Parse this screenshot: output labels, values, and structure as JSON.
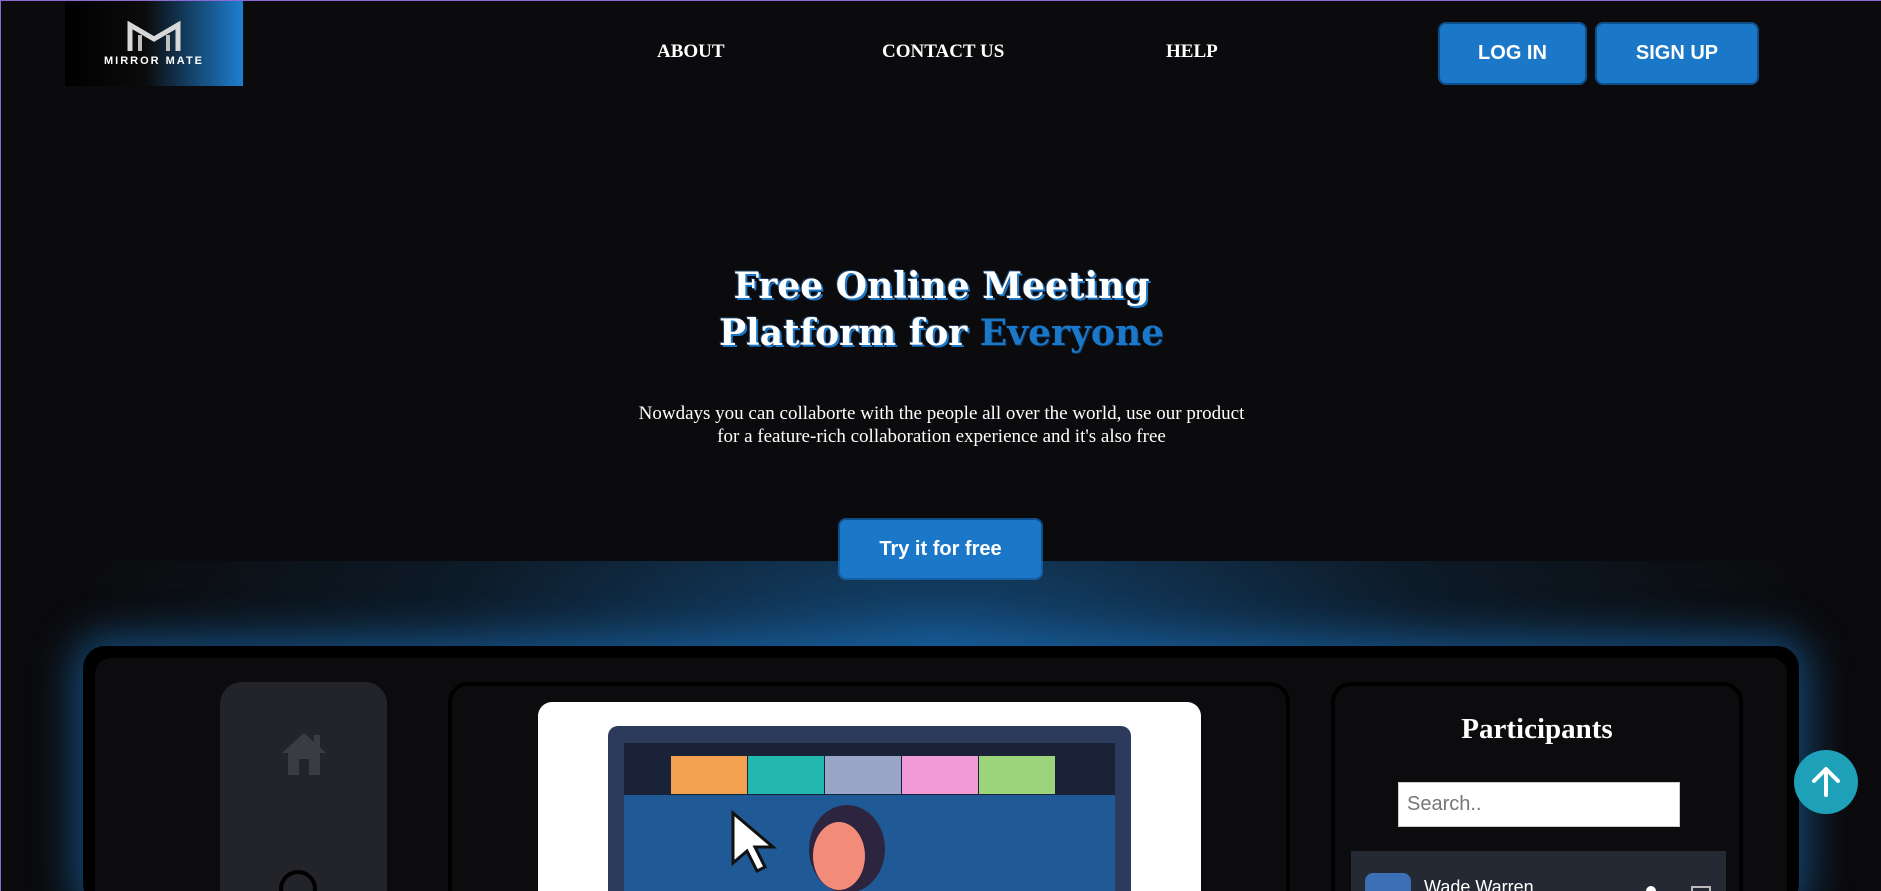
{
  "brand": {
    "name": "MIRROR MATE",
    "logo_icon": "mirror-mate-logo-icon"
  },
  "nav": {
    "about": "ABOUT",
    "contact": "CONTACT US",
    "help": "HELP"
  },
  "auth": {
    "login": "LOG IN",
    "signup": "SIGN UP"
  },
  "hero": {
    "title_line1": "Free Online Meeting",
    "title_line2_prefix": "Platform for ",
    "title_line2_accent": "Everyone",
    "subtitle_line1": "Nowdays you can collaborte with the people all over the world, use our product",
    "subtitle_line2": "for a feature-rich collaboration experience and it's also free",
    "cta": "Try it for free"
  },
  "app_preview": {
    "sidebar_icons": [
      "home-icon",
      "circle-icon"
    ],
    "participants": {
      "title": "Participants",
      "search_placeholder": "Search..",
      "list": [
        {
          "name": "Wade Warren"
        }
      ]
    }
  },
  "colors": {
    "accent": "#1b78c8",
    "background": "#0b0b0d",
    "scroll_top": "#1ea0b8"
  },
  "scroll_top_icon": "arrow-up-icon"
}
